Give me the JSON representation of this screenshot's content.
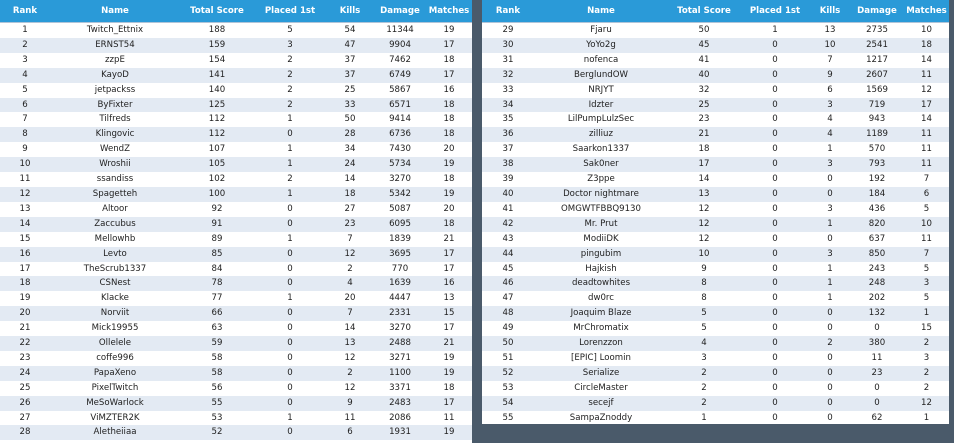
{
  "columns": [
    "Rank",
    "Name",
    "Total Score",
    "Placed 1st",
    "Kills",
    "Damage",
    "Matches"
  ],
  "left_rows": [
    [
      "1",
      "Twitch_Ettnix",
      "188",
      "5",
      "54",
      "11344",
      "19"
    ],
    [
      "2",
      "ERNST54",
      "159",
      "3",
      "47",
      "9904",
      "17"
    ],
    [
      "3",
      "zzpE",
      "154",
      "2",
      "37",
      "7462",
      "18"
    ],
    [
      "4",
      "KayoD",
      "141",
      "2",
      "37",
      "6749",
      "17"
    ],
    [
      "5",
      "jetpackss",
      "140",
      "2",
      "25",
      "5867",
      "16"
    ],
    [
      "6",
      "ByFixter",
      "125",
      "2",
      "33",
      "6571",
      "18"
    ],
    [
      "7",
      "Tilfreds",
      "112",
      "1",
      "50",
      "9414",
      "18"
    ],
    [
      "8",
      "Klingovic",
      "112",
      "0",
      "28",
      "6736",
      "18"
    ],
    [
      "9",
      "WendZ",
      "107",
      "1",
      "34",
      "7430",
      "20"
    ],
    [
      "10",
      "Wroshii",
      "105",
      "1",
      "24",
      "5734",
      "19"
    ],
    [
      "11",
      "ssandiss",
      "102",
      "2",
      "14",
      "3270",
      "18"
    ],
    [
      "12",
      "Spagetteh",
      "100",
      "1",
      "18",
      "5342",
      "19"
    ],
    [
      "13",
      "Altoor",
      "92",
      "0",
      "27",
      "5087",
      "20"
    ],
    [
      "14",
      "Zaccubus",
      "91",
      "0",
      "23",
      "6095",
      "18"
    ],
    [
      "15",
      "Mellowhb",
      "89",
      "1",
      "7",
      "1839",
      "21"
    ],
    [
      "16",
      "Levto",
      "85",
      "0",
      "12",
      "3695",
      "17"
    ],
    [
      "17",
      "TheScrub1337",
      "84",
      "0",
      "2",
      "770",
      "17"
    ],
    [
      "18",
      "CSNest",
      "78",
      "0",
      "4",
      "1639",
      "16"
    ],
    [
      "19",
      "Klacke",
      "77",
      "1",
      "20",
      "4447",
      "13"
    ],
    [
      "20",
      "Norviit",
      "66",
      "0",
      "7",
      "2331",
      "15"
    ],
    [
      "21",
      "Mick19955",
      "63",
      "0",
      "14",
      "3270",
      "17"
    ],
    [
      "22",
      "Ollelele",
      "59",
      "0",
      "13",
      "2488",
      "21"
    ],
    [
      "23",
      "coffe996",
      "58",
      "0",
      "12",
      "3271",
      "19"
    ],
    [
      "24",
      "PapaXeno",
      "58",
      "0",
      "2",
      "1100",
      "19"
    ],
    [
      "25",
      "PixelTwitch",
      "56",
      "0",
      "12",
      "3371",
      "18"
    ],
    [
      "26",
      "MeSoWarlock",
      "55",
      "0",
      "9",
      "2483",
      "17"
    ],
    [
      "27",
      "ViMZTER2K",
      "53",
      "1",
      "11",
      "2086",
      "11"
    ],
    [
      "28",
      "Aletheiiaa",
      "52",
      "0",
      "6",
      "1931",
      "19"
    ]
  ],
  "right_rows": [
    [
      "29",
      "Fjaru",
      "50",
      "1",
      "13",
      "2735",
      "10"
    ],
    [
      "30",
      "YoYo2g",
      "45",
      "0",
      "10",
      "2541",
      "18"
    ],
    [
      "31",
      "nofenca",
      "41",
      "0",
      "7",
      "1217",
      "14"
    ],
    [
      "32",
      "BerglundOW",
      "40",
      "0",
      "9",
      "2607",
      "11"
    ],
    [
      "33",
      "NRJYT",
      "32",
      "0",
      "6",
      "1569",
      "12"
    ],
    [
      "34",
      "Idzter",
      "25",
      "0",
      "3",
      "719",
      "17"
    ],
    [
      "35",
      "LilPumpLulzSec",
      "23",
      "0",
      "4",
      "943",
      "14"
    ],
    [
      "36",
      "zilliuz",
      "21",
      "0",
      "4",
      "1189",
      "11"
    ],
    [
      "37",
      "Saarkon1337",
      "18",
      "0",
      "1",
      "570",
      "11"
    ],
    [
      "38",
      "Sak0ner",
      "17",
      "0",
      "3",
      "793",
      "11"
    ],
    [
      "39",
      "Z3ppe",
      "14",
      "0",
      "0",
      "192",
      "7"
    ],
    [
      "40",
      "Doctor nightmare",
      "13",
      "0",
      "0",
      "184",
      "6"
    ],
    [
      "41",
      "OMGWTFBBQ9130",
      "12",
      "0",
      "3",
      "436",
      "5"
    ],
    [
      "42",
      "Mr. Prut",
      "12",
      "0",
      "1",
      "820",
      "10"
    ],
    [
      "43",
      "ModiiDK",
      "12",
      "0",
      "0",
      "637",
      "11"
    ],
    [
      "44",
      "pingubim",
      "10",
      "0",
      "3",
      "850",
      "7"
    ],
    [
      "45",
      "Hajkish",
      "9",
      "0",
      "1",
      "243",
      "5"
    ],
    [
      "46",
      "deadtowhites",
      "8",
      "0",
      "1",
      "248",
      "3"
    ],
    [
      "47",
      "dw0rc",
      "8",
      "0",
      "1",
      "202",
      "5"
    ],
    [
      "48",
      "Joaquim Blaze",
      "5",
      "0",
      "0",
      "132",
      "1"
    ],
    [
      "49",
      "MrChromatix",
      "5",
      "0",
      "0",
      "0",
      "15"
    ],
    [
      "50",
      "Lorenzzon",
      "4",
      "0",
      "2",
      "380",
      "2"
    ],
    [
      "51",
      "[EPIC] Loomin",
      "3",
      "0",
      "0",
      "11",
      "3"
    ],
    [
      "52",
      "Serialize",
      "2",
      "0",
      "0",
      "23",
      "2"
    ],
    [
      "53",
      "CircleMaster",
      "2",
      "0",
      "0",
      "0",
      "2"
    ],
    [
      "54",
      "secejf",
      "2",
      "0",
      "0",
      "0",
      "12"
    ],
    [
      "55",
      "SampaZnoddy",
      "1",
      "0",
      "0",
      "62",
      "1"
    ]
  ]
}
